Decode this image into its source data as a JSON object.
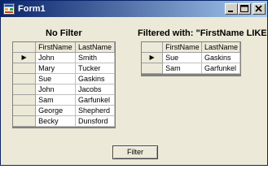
{
  "window": {
    "title": "Form1"
  },
  "left_panel": {
    "caption": "No Filter",
    "columns": [
      "FirstName",
      "LastName"
    ],
    "current_row_marker": "▶",
    "rows": [
      {
        "first": "John",
        "last": "Smith"
      },
      {
        "first": "Mary",
        "last": "Tucker"
      },
      {
        "first": "Sue",
        "last": "Gaskins"
      },
      {
        "first": "John",
        "last": "Jacobs"
      },
      {
        "first": "Sam",
        "last": "Garfunkel"
      },
      {
        "first": "George",
        "last": "Shepherd"
      },
      {
        "first": "Becky",
        "last": "Dunsford"
      }
    ]
  },
  "right_panel": {
    "caption": "Filtered with: \"FirstName LIKE 's*'\"",
    "columns": [
      "FirstName",
      "LastName"
    ],
    "current_row_marker": "▶",
    "rows": [
      {
        "first": "Sue",
        "last": "Gaskins"
      },
      {
        "first": "Sam",
        "last": "Garfunkel"
      }
    ]
  },
  "filter_button": {
    "label": "Filter"
  }
}
